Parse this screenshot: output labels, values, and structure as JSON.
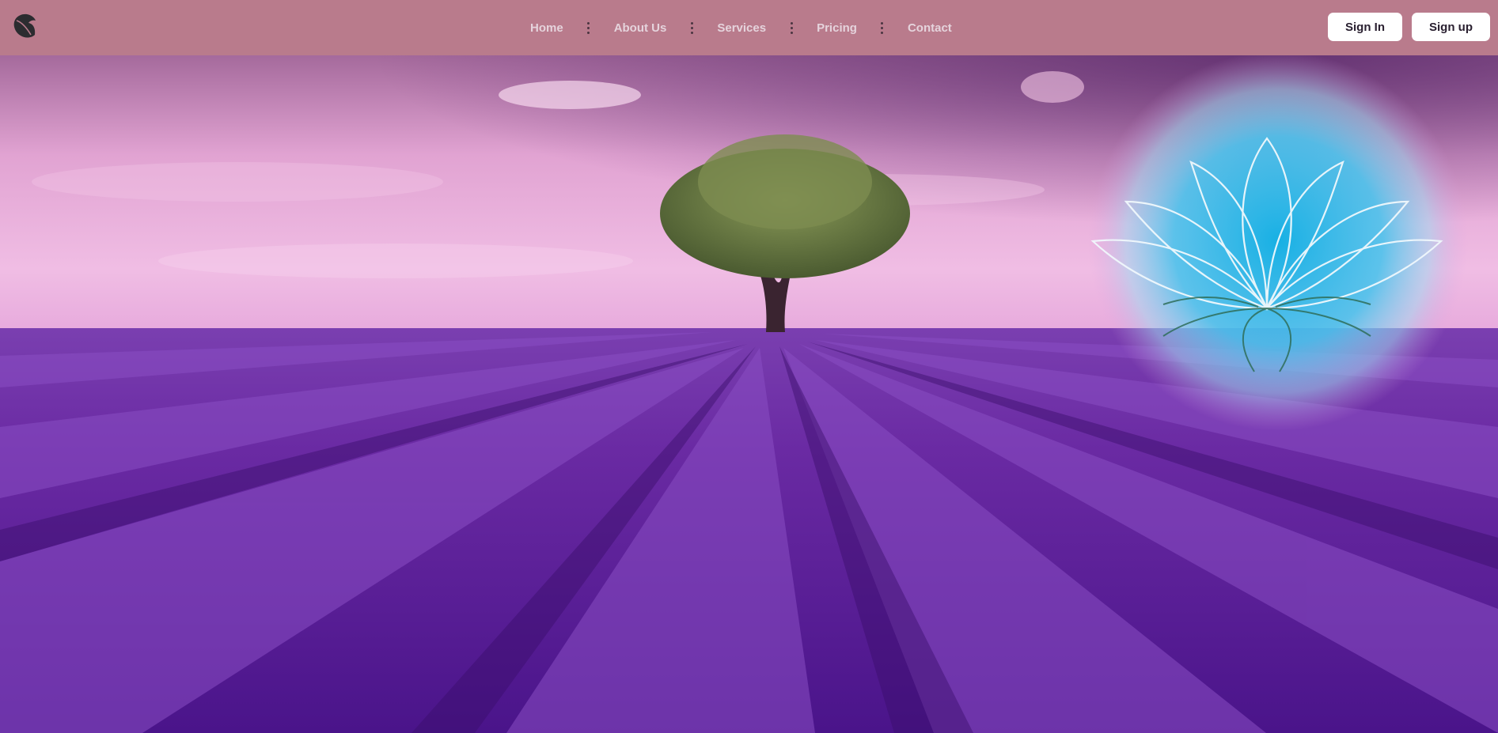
{
  "header": {
    "logo_icon": "leaf-icon",
    "nav": [
      {
        "label": "Home"
      },
      {
        "label": "About Us"
      },
      {
        "label": "Services"
      },
      {
        "label": "Pricing"
      },
      {
        "label": "Contact"
      }
    ],
    "sign_in_label": "Sign In",
    "sign_up_label": "Sign up"
  },
  "hero": {
    "image": "lavender-field-with-tree",
    "emblem_icon": "lotus-icon"
  },
  "colors": {
    "navbar": "#b97b8c",
    "button_bg": "#ffffff",
    "lavender": "#6a2aa3",
    "sky": "#e6a6d6",
    "lotus_glow": "#2bb4e4"
  }
}
